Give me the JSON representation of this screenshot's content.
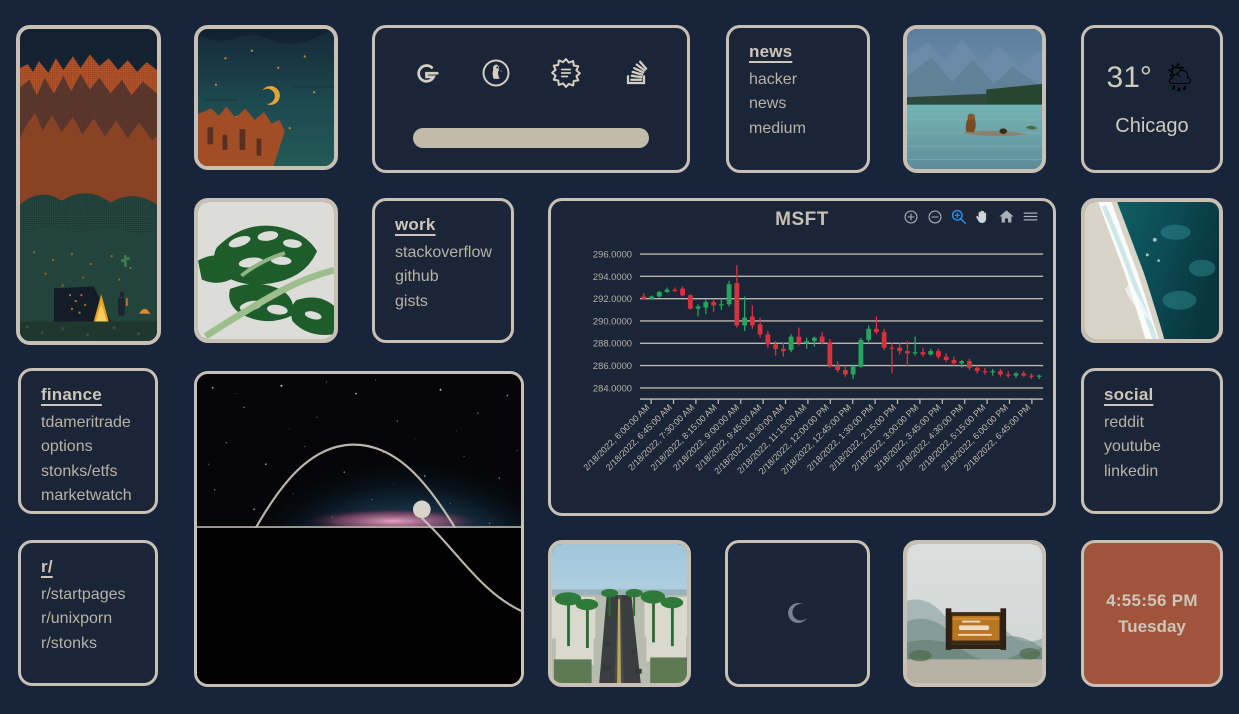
{
  "page": {
    "background": "#18243a",
    "accent": "#c8c0b4",
    "card_bg": "#1a2537",
    "clock_bg": "#a0543c"
  },
  "search": {
    "placeholder": "",
    "value": "",
    "engines": [
      {
        "name": "google-icon",
        "label": "Google"
      },
      {
        "name": "duckduckgo-icon",
        "label": "DuckDuckGo"
      },
      {
        "name": "searx-icon",
        "label": "Searx"
      },
      {
        "name": "stackoverflow-icon",
        "label": "Stack Overflow"
      }
    ]
  },
  "link_cards": {
    "news": {
      "heading": "news",
      "links": [
        "hacker",
        "news",
        "medium"
      ]
    },
    "work": {
      "heading": "work",
      "links": [
        "stackoverflow",
        "github",
        "gists"
      ]
    },
    "finance": {
      "heading": "finance",
      "links": [
        "tdameritrade",
        "options",
        "stonks/etfs",
        "marketwatch"
      ]
    },
    "reddit": {
      "heading": "r/",
      "links": [
        "r/startpages",
        "r/unixporn",
        "r/stonks"
      ]
    },
    "social": {
      "heading": "social",
      "links": [
        "reddit",
        "youtube",
        "linkedin"
      ]
    }
  },
  "weather": {
    "temperature": "31°",
    "icon": "sun-behind-rain-cloud-icon",
    "icon_glyph": "🌦",
    "city": "Chicago"
  },
  "clock": {
    "time": "4:55:56 PM",
    "day": "Tuesday"
  },
  "moon": {
    "phase_icon": "waning-crescent-moon-icon",
    "phase_label": "waning crescent"
  },
  "sun_widget": {
    "name": "sun-position-arc",
    "horizon_label": "horizon",
    "sun_state": "setting"
  },
  "photos": [
    {
      "name": "photo-pixelart-canyon-camp",
      "alt": "pixel art desert canyon with campsite"
    },
    {
      "name": "photo-pixelart-night-moon",
      "alt": "pixel art night sky with crescent moon over mesa"
    },
    {
      "name": "photo-monstera-leaf",
      "alt": "monstera leaf close-up"
    },
    {
      "name": "photo-bear-lake",
      "alt": "bear on a log in an alpine lake"
    },
    {
      "name": "photo-ocean-shoreline",
      "alt": "aerial view of turquoise ocean meeting sand"
    },
    {
      "name": "photo-palm-street",
      "alt": "palm-lined coastal street"
    },
    {
      "name": "photo-alaska-sign",
      "alt": "welcome to Alaska roadside sign on a mountain overlook"
    }
  ],
  "chart_data": {
    "type": "candlestick",
    "title": "MSFT",
    "xlabel": "",
    "ylabel": "",
    "ylim": [
      283.0,
      297.0
    ],
    "yticks": [
      "284.0000",
      "286.0000",
      "288.0000",
      "290.0000",
      "292.0000",
      "294.0000",
      "296.0000"
    ],
    "grid": true,
    "legend": "none",
    "date": "2/18/2022",
    "xticks": [
      "2/18/2022, 6:00:00 AM",
      "2/18/2022, 6:45:00 AM",
      "2/18/2022, 7:30:00 AM",
      "2/18/2022, 8:15:00 AM",
      "2/18/2022, 9:00:00 AM",
      "2/18/2022, 9:45:00 AM",
      "2/18/2022, 10:30:00 AM",
      "2/18/2022, 11:15:00 AM",
      "2/18/2022, 12:00:00 PM",
      "2/18/2022, 12:45:00 PM",
      "2/18/2022, 1:30:00 PM",
      "2/18/2022, 2:15:00 PM",
      "2/18/2022, 3:00:00 PM",
      "2/18/2022, 3:45:00 PM",
      "2/18/2022, 4:30:00 PM",
      "2/18/2022, 5:15:00 PM",
      "2/18/2022, 6:00:00 PM",
      "2/18/2022, 6:45:00 PM"
    ],
    "colors": {
      "up": "#26a65b",
      "down": "#d8323c",
      "grid": "#c9c3b7"
    },
    "candles": [
      {
        "o": 292.2,
        "h": 292.5,
        "l": 291.9,
        "c": 292.0
      },
      {
        "o": 292.0,
        "h": 292.3,
        "l": 291.9,
        "c": 292.2
      },
      {
        "o": 292.2,
        "h": 292.7,
        "l": 292.1,
        "c": 292.6
      },
      {
        "o": 292.6,
        "h": 293.0,
        "l": 292.5,
        "c": 292.8
      },
      {
        "o": 292.8,
        "h": 293.0,
        "l": 292.6,
        "c": 292.7
      },
      {
        "o": 292.9,
        "h": 293.1,
        "l": 292.2,
        "c": 292.3
      },
      {
        "o": 292.3,
        "h": 292.4,
        "l": 291.0,
        "c": 291.1
      },
      {
        "o": 291.1,
        "h": 291.5,
        "l": 290.4,
        "c": 291.3
      },
      {
        "o": 291.2,
        "h": 291.9,
        "l": 290.6,
        "c": 291.7
      },
      {
        "o": 291.7,
        "h": 292.0,
        "l": 290.8,
        "c": 291.4
      },
      {
        "o": 291.4,
        "h": 292.0,
        "l": 291.0,
        "c": 291.5
      },
      {
        "o": 291.5,
        "h": 293.6,
        "l": 291.3,
        "c": 293.3
      },
      {
        "o": 293.4,
        "h": 295.0,
        "l": 289.4,
        "c": 289.6
      },
      {
        "o": 289.6,
        "h": 292.2,
        "l": 289.1,
        "c": 290.3
      },
      {
        "o": 290.4,
        "h": 291.4,
        "l": 289.3,
        "c": 289.6
      },
      {
        "o": 289.7,
        "h": 290.3,
        "l": 288.5,
        "c": 288.8
      },
      {
        "o": 288.8,
        "h": 289.1,
        "l": 287.6,
        "c": 287.9
      },
      {
        "o": 287.9,
        "h": 288.2,
        "l": 286.9,
        "c": 287.5
      },
      {
        "o": 287.5,
        "h": 288.1,
        "l": 286.8,
        "c": 287.3
      },
      {
        "o": 287.4,
        "h": 288.8,
        "l": 287.2,
        "c": 288.6
      },
      {
        "o": 288.6,
        "h": 289.4,
        "l": 287.8,
        "c": 288.0
      },
      {
        "o": 288.0,
        "h": 288.5,
        "l": 287.5,
        "c": 288.2
      },
      {
        "o": 288.2,
        "h": 288.6,
        "l": 287.7,
        "c": 288.5
      },
      {
        "o": 288.6,
        "h": 289.0,
        "l": 287.9,
        "c": 288.1
      },
      {
        "o": 288.1,
        "h": 288.4,
        "l": 285.8,
        "c": 286.0
      },
      {
        "o": 286.0,
        "h": 286.4,
        "l": 285.4,
        "c": 285.6
      },
      {
        "o": 285.6,
        "h": 286.0,
        "l": 285.0,
        "c": 285.2
      },
      {
        "o": 285.2,
        "h": 286.1,
        "l": 284.8,
        "c": 285.9
      },
      {
        "o": 285.9,
        "h": 288.5,
        "l": 285.8,
        "c": 288.3
      },
      {
        "o": 288.3,
        "h": 289.6,
        "l": 288.0,
        "c": 289.3
      },
      {
        "o": 289.3,
        "h": 290.4,
        "l": 288.8,
        "c": 289.0
      },
      {
        "o": 289.0,
        "h": 289.3,
        "l": 287.4,
        "c": 287.6
      },
      {
        "o": 287.6,
        "h": 288.0,
        "l": 285.3,
        "c": 287.5
      },
      {
        "o": 287.6,
        "h": 288.0,
        "l": 287.0,
        "c": 287.3
      },
      {
        "o": 287.3,
        "h": 288.2,
        "l": 285.9,
        "c": 287.1
      },
      {
        "o": 287.1,
        "h": 288.6,
        "l": 286.9,
        "c": 287.2
      },
      {
        "o": 287.2,
        "h": 287.6,
        "l": 286.8,
        "c": 287.0
      },
      {
        "o": 287.0,
        "h": 287.5,
        "l": 286.9,
        "c": 287.3
      },
      {
        "o": 287.3,
        "h": 287.5,
        "l": 286.6,
        "c": 286.8
      },
      {
        "o": 286.8,
        "h": 287.1,
        "l": 286.3,
        "c": 286.5
      },
      {
        "o": 286.5,
        "h": 286.8,
        "l": 286.0,
        "c": 286.2
      },
      {
        "o": 286.2,
        "h": 286.5,
        "l": 285.8,
        "c": 286.4
      },
      {
        "o": 286.4,
        "h": 286.6,
        "l": 285.6,
        "c": 285.8
      },
      {
        "o": 285.8,
        "h": 286.0,
        "l": 285.3,
        "c": 285.5
      },
      {
        "o": 285.5,
        "h": 285.8,
        "l": 285.2,
        "c": 285.4
      },
      {
        "o": 285.4,
        "h": 285.7,
        "l": 285.1,
        "c": 285.5
      },
      {
        "o": 285.5,
        "h": 285.7,
        "l": 285.0,
        "c": 285.2
      },
      {
        "o": 285.2,
        "h": 285.5,
        "l": 284.9,
        "c": 285.1
      },
      {
        "o": 285.1,
        "h": 285.4,
        "l": 284.9,
        "c": 285.3
      },
      {
        "o": 285.3,
        "h": 285.5,
        "l": 285.0,
        "c": 285.1
      },
      {
        "o": 285.1,
        "h": 285.3,
        "l": 284.8,
        "c": 285.0
      },
      {
        "o": 285.0,
        "h": 285.2,
        "l": 284.8,
        "c": 285.1
      }
    ],
    "toolbar": [
      {
        "name": "zoom-in-icon",
        "label": "Zoom in",
        "active": false
      },
      {
        "name": "zoom-out-icon",
        "label": "Zoom out",
        "active": false
      },
      {
        "name": "zoom-select-icon",
        "label": "Box zoom",
        "active": true
      },
      {
        "name": "pan-hand-icon",
        "label": "Pan",
        "active": false
      },
      {
        "name": "home-icon",
        "label": "Reset",
        "active": false
      },
      {
        "name": "menu-icon",
        "label": "Menu",
        "active": false
      }
    ]
  }
}
